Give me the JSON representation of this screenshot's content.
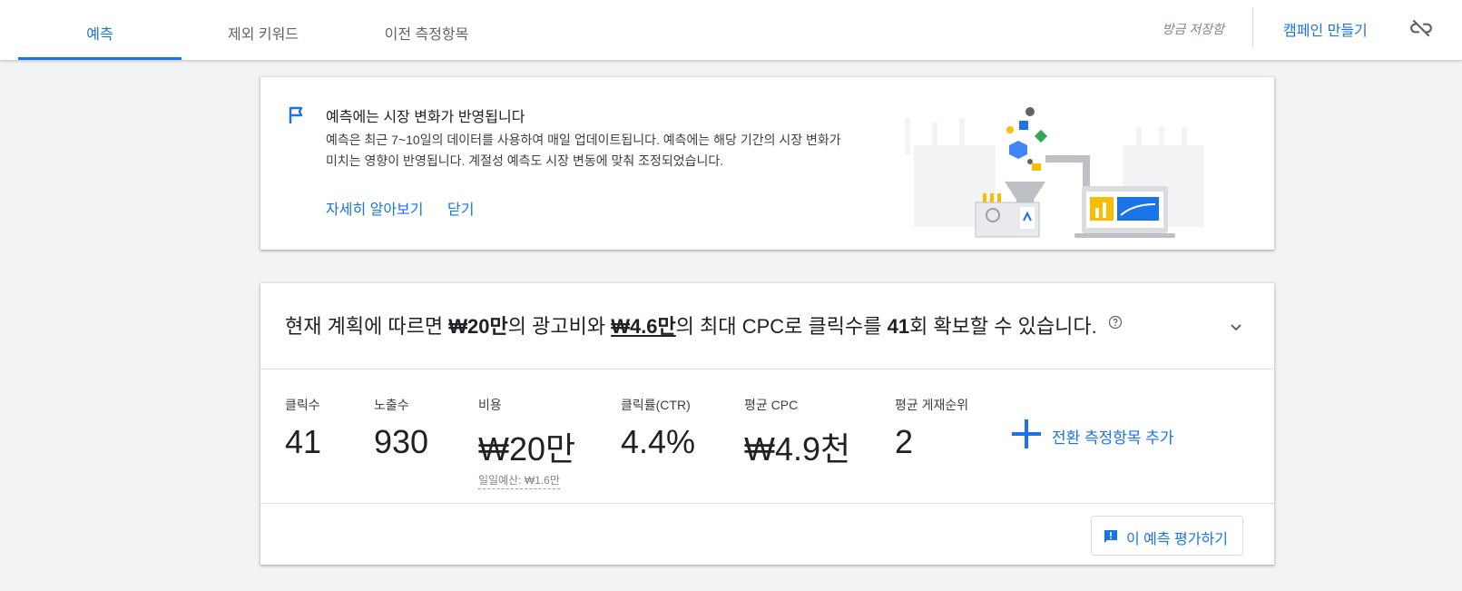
{
  "tabs": [
    {
      "label": "예측",
      "active": true
    },
    {
      "label": "제외 키워드",
      "active": false
    },
    {
      "label": "이전 측정항목",
      "active": false
    }
  ],
  "header": {
    "saved_status": "방금 저장함",
    "create_campaign": "캠페인 만들기",
    "unlink_icon": "link-off-icon"
  },
  "notice": {
    "title": "예측에는 시장 변화가 반영됩니다",
    "body": "예측은 최근 7~10일의 데이터를 사용하여 매일 업데이트됩니다. 예측에는 해당 기간의 시장 변화가 미치는 영향이 반영됩니다. 계절성 예측도 시장 변동에 맞춰 조정되었습니다.",
    "learn_more": "자세히 알아보기",
    "close": "닫기",
    "icon": "flag-icon"
  },
  "summary": {
    "part1": "현재 계획에 따르면 ",
    "budget": "₩20만",
    "part2": "의 광고비와 ",
    "max_cpc": "₩4.6만",
    "part3": "의 최대 CPC로 클릭수를 ",
    "clicks": "41",
    "part4": "회 확보할 수 있습니다."
  },
  "metrics": [
    {
      "label": "클릭수",
      "value": "41"
    },
    {
      "label": "노출수",
      "value": "930"
    },
    {
      "label": "비용",
      "value": "₩20만",
      "sub": "일일예산: ₩1.6만"
    },
    {
      "label": "클릭률(CTR)",
      "value": "4.4%"
    },
    {
      "label": "평균 CPC",
      "value": "₩4.9천"
    },
    {
      "label": "평균 게재순위",
      "value": "2"
    }
  ],
  "add_conversion": "전환 측정항목 추가",
  "rate_forecast": "이 예측 평가하기",
  "colors": {
    "accent": "#1a73e8",
    "background": "#f1f3f4"
  }
}
